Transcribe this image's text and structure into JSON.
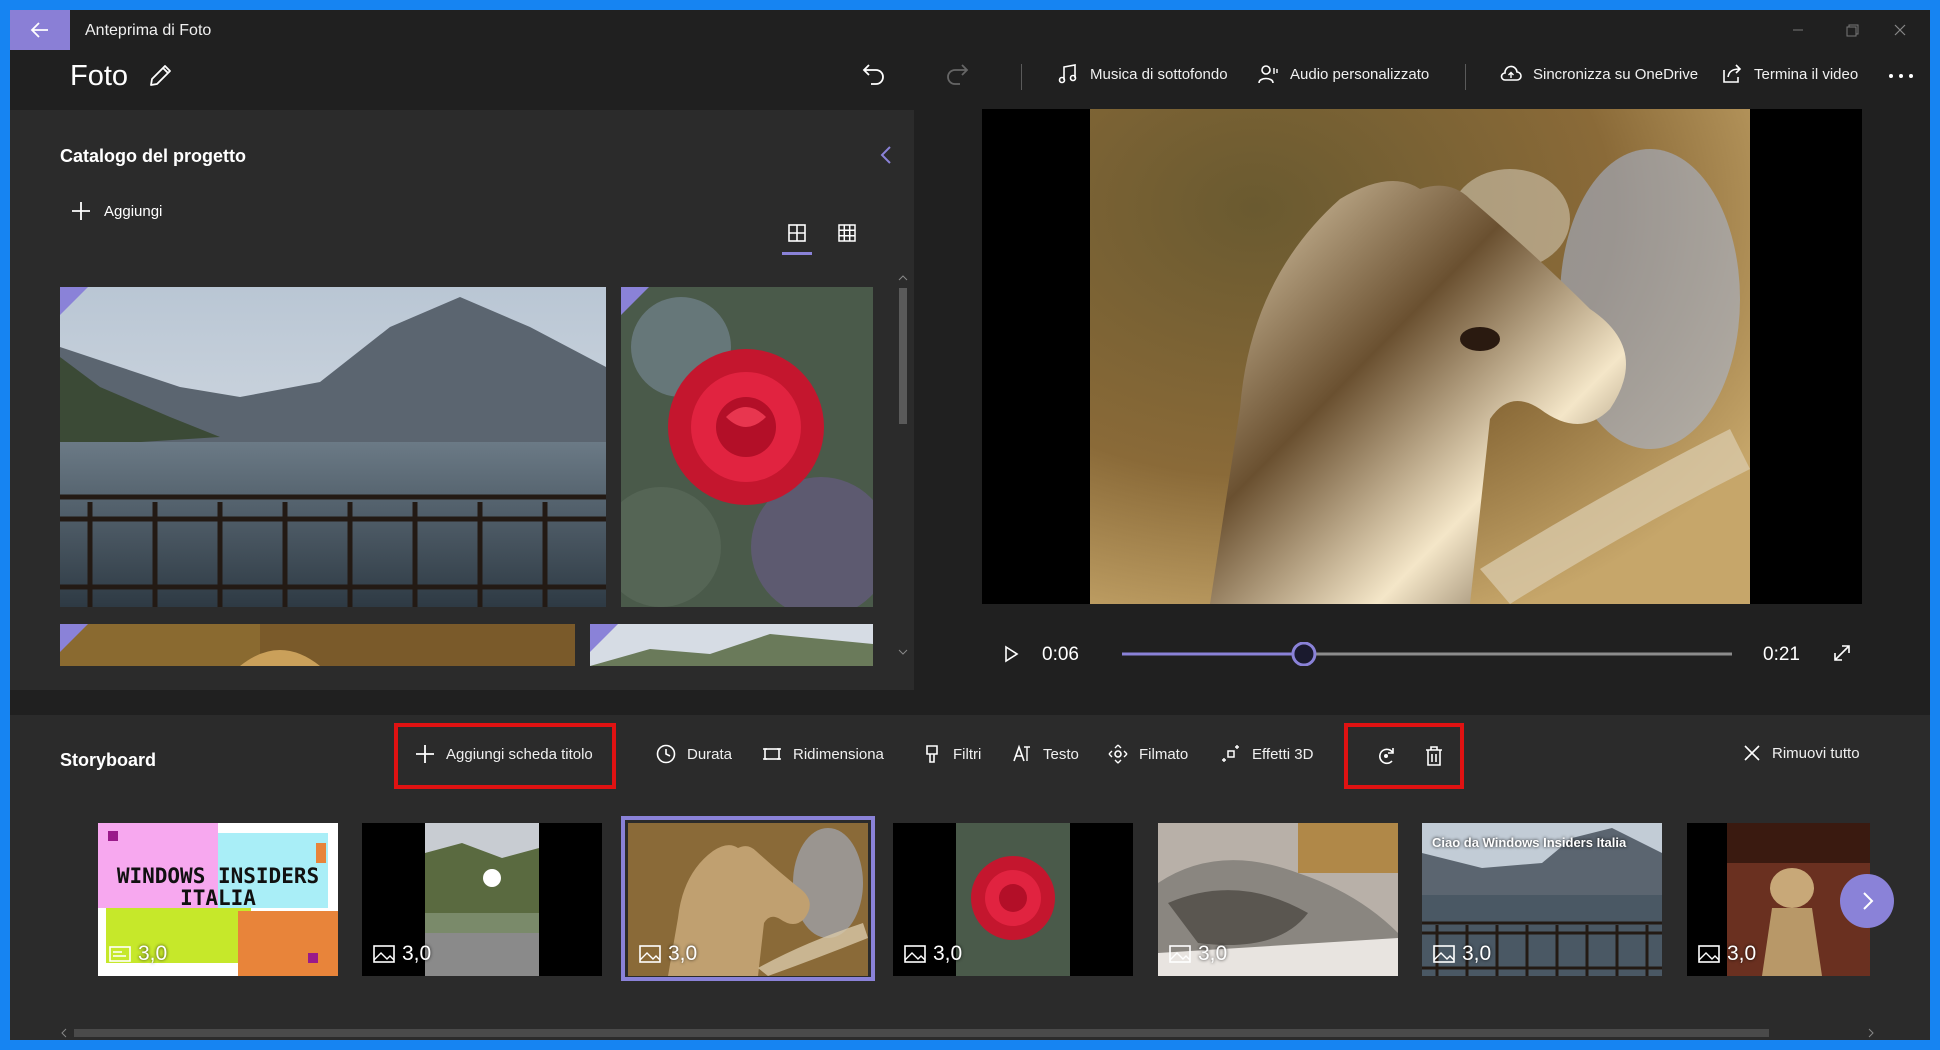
{
  "titlebar": {
    "title": "Anteprima di Foto",
    "back_icon": "arrow-left-icon",
    "accent": "#8a7fd6"
  },
  "header": {
    "app_title": "Foto",
    "edit_icon": "pencil-icon",
    "undo_icon": "undo-icon",
    "redo_icon": "redo-icon",
    "music_label": "Musica di sottofondo",
    "custom_audio_label": "Audio personalizzato",
    "sync_label": "Sincronizza su OneDrive",
    "finish_label": "Termina il video",
    "more_icon": "ellipsis-icon"
  },
  "catalog": {
    "title": "Catalogo del progetto",
    "add_label": "Aggiungi",
    "collapse_icon": "chevron-left-icon",
    "view_large_icon": "grid-large-icon",
    "view_small_icon": "grid-small-icon",
    "items": [
      "lake-photo",
      "rose-photo",
      "horse-photo",
      "landscape-photo"
    ]
  },
  "player": {
    "current_time": "0:06",
    "total_time": "0:21",
    "progress": 0.29,
    "play_icon": "play-icon",
    "fullscreen_icon": "expand-icon"
  },
  "storyboard": {
    "title": "Storyboard",
    "add_title_card": "Aggiungi scheda titolo",
    "duration": "Durata",
    "resize": "Ridimensiona",
    "filters": "Filtri",
    "text": "Testo",
    "motion": "Filmato",
    "effects_3d": "Effetti 3D",
    "remove_all": "Rimuovi tutto",
    "rotate_icon": "rotate-icon",
    "delete_icon": "trash-icon",
    "highlight_color": "#e01212",
    "clips": [
      {
        "kind": "title",
        "duration": "3,0",
        "card_text": "WINDOWS INSIDERS ITALIA"
      },
      {
        "kind": "photo",
        "duration": "3,0"
      },
      {
        "kind": "photo",
        "duration": "3,0",
        "selected": true
      },
      {
        "kind": "photo",
        "duration": "3,0"
      },
      {
        "kind": "photo",
        "duration": "3,0"
      },
      {
        "kind": "photo",
        "duration": "3,0",
        "overlay": "Ciao da Windows Insiders Italia"
      },
      {
        "kind": "photo",
        "duration": "3,0"
      }
    ],
    "next_icon": "chevron-right-icon"
  }
}
